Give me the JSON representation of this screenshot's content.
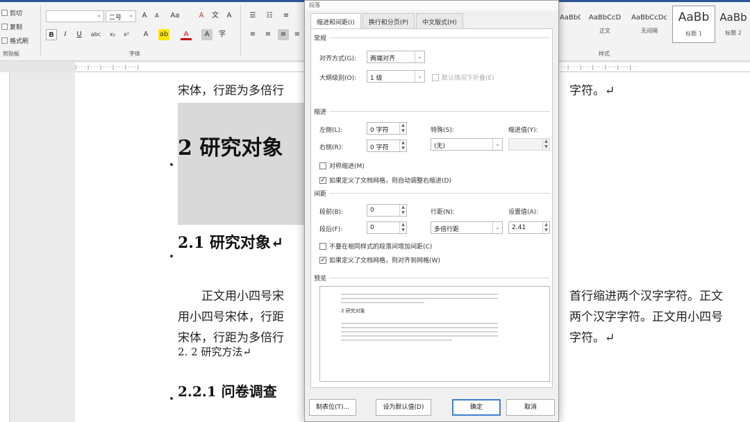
{
  "ribbon": {
    "clipboard": {
      "cut": "剪切",
      "copy": "复制",
      "format_painter": "格式刷",
      "label": "剪贴板"
    },
    "font": {
      "name": "",
      "size": "二号",
      "label": "字体"
    },
    "styles": {
      "label": "样式",
      "items": [
        {
          "sample": "AaBbCcD",
          "name": ""
        },
        {
          "sample": "AaBbCcD",
          "name": "正文"
        },
        {
          "sample": "AaBbCcDc",
          "name": "无间隔"
        },
        {
          "sample": "AaBb",
          "name": "标题 1"
        },
        {
          "sample": "AaBb",
          "name": "标题 2"
        }
      ]
    }
  },
  "document": {
    "line1": "宋体，行距为多倍行",
    "line1_tail": "字符。↵",
    "heading1": "2  研究对象",
    "heading2": "2.1  研究对象↵",
    "para1a": "正文用小四号宋",
    "para1b": "首行缩进两个汉字字符。正文",
    "para2a": "用小四号宋体，行距",
    "para2b": "两个汉字字符。正文用小四号",
    "para3a": "宋体，行距为多倍行",
    "para3b": "字符。↵",
    "line_method": "2. 2  研究方法↵",
    "heading3": "2.2.1  问卷调查"
  },
  "dialog": {
    "title": "段落",
    "tabs": [
      "缩进和间距(I)",
      "换行和分页(P)",
      "中文版式(H)"
    ],
    "general": {
      "title": "常规",
      "alignment_label": "对齐方式(G):",
      "alignment_value": "两端对齐",
      "outline_label": "大纲级别(O):",
      "outline_value": "1 级",
      "collapsed_label": "默认情况下折叠(E)"
    },
    "indent": {
      "title": "缩进",
      "left_label": "左侧(L):",
      "left_value": "0 字符",
      "right_label": "右侧(R):",
      "right_value": "0 字符",
      "special_label": "特殊(S):",
      "special_value": "(无)",
      "by_label": "缩进值(Y):",
      "by_value": "",
      "mirror_label": "对称缩进(M)",
      "auto_label": "如果定义了文档网格，则自动调整右缩进(D)"
    },
    "spacing": {
      "title": "间距",
      "before_label": "段前(B):",
      "before_value": "0",
      "after_label": "段后(F):",
      "after_value": "0",
      "line_label": "行距(N):",
      "line_value": "多倍行距",
      "at_label": "设置值(A):",
      "at_value": "2.41",
      "no_space_label": "不要在相同样式的段落间增加间距(C)",
      "grid_label": "如果定义了文档网格，则对齐到网格(W)"
    },
    "preview": {
      "title": "预览",
      "sample": "2 研究对象"
    },
    "buttons": {
      "tabs": "制表位(T)...",
      "default": "设为默认值(D)",
      "ok": "确定",
      "cancel": "取消"
    }
  }
}
